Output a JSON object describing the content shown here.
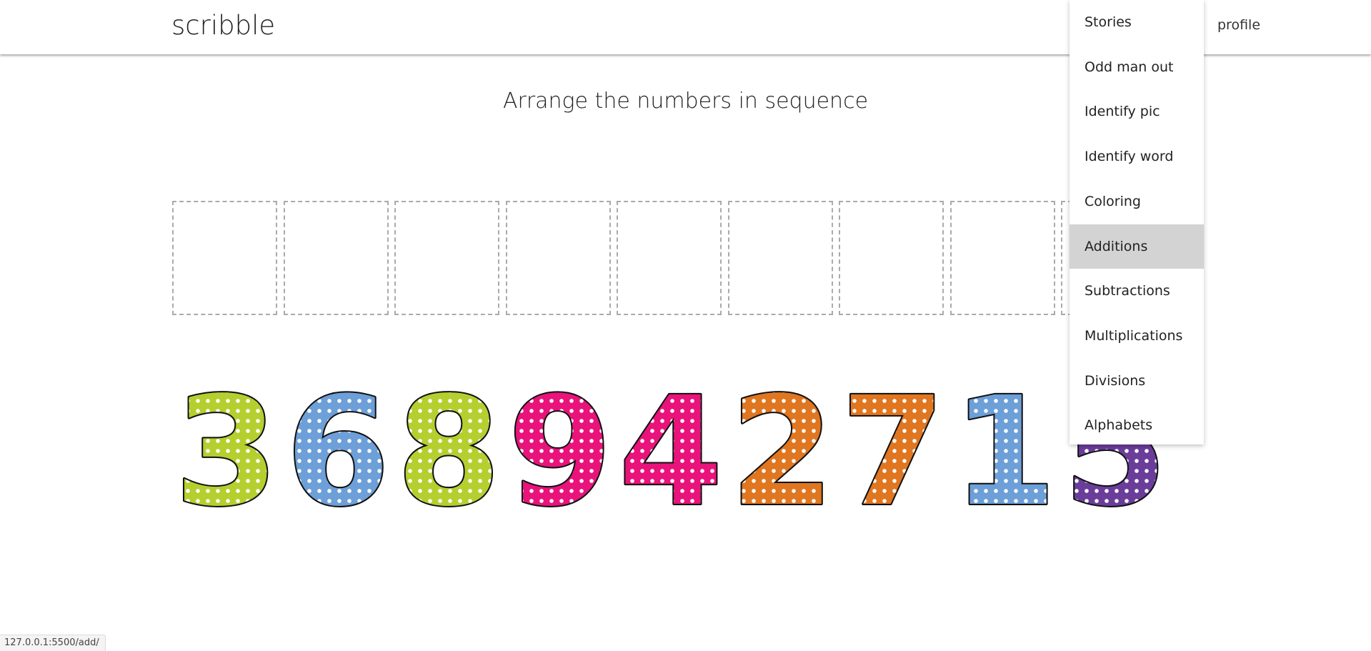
{
  "navbar": {
    "brand": "scribble",
    "profile_label": "profile"
  },
  "page": {
    "title": "Arrange the numbers in sequence"
  },
  "slots_count": 9,
  "number_tiles": [
    {
      "digit": "3",
      "color": "#b5cf2f"
    },
    {
      "digit": "6",
      "color": "#6d9fd8"
    },
    {
      "digit": "8",
      "color": "#b5cf2f"
    },
    {
      "digit": "9",
      "color": "#e9137b"
    },
    {
      "digit": "4",
      "color": "#e9137b"
    },
    {
      "digit": "2",
      "color": "#e07620"
    },
    {
      "digit": "7",
      "color": "#e07620"
    },
    {
      "digit": "1",
      "color": "#6d9fd8"
    },
    {
      "digit": "5",
      "color": "#6a3d9a"
    }
  ],
  "dropdown": {
    "items": [
      {
        "label": "Stories",
        "active": false
      },
      {
        "label": "Odd man out",
        "active": false
      },
      {
        "label": "Identify pic",
        "active": false
      },
      {
        "label": "Identify word",
        "active": false
      },
      {
        "label": "Coloring",
        "active": false
      },
      {
        "label": "Additions",
        "active": true
      },
      {
        "label": "Subtractions",
        "active": false
      },
      {
        "label": "Multiplications",
        "active": false
      },
      {
        "label": "Divisions",
        "active": false
      },
      {
        "label": "Alphabets",
        "active": false
      }
    ]
  },
  "statusbar": {
    "url": "127.0.0.1:5500/add/"
  }
}
